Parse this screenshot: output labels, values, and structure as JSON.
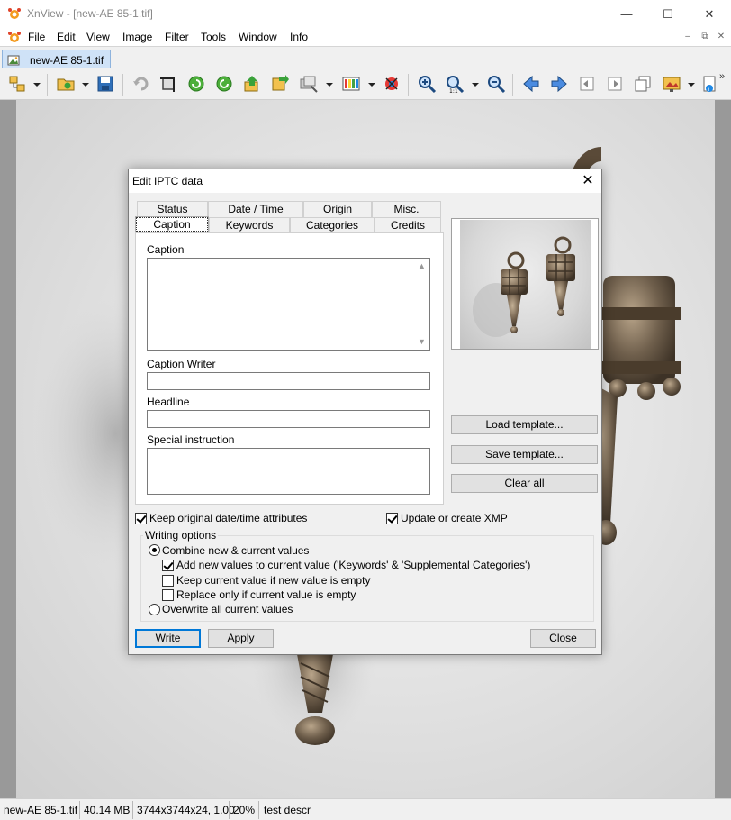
{
  "window": {
    "title": "XnView - [new-AE 85-1.tif]",
    "minimize": "—",
    "maximize": "☐",
    "close": "✕"
  },
  "menu": {
    "items": [
      "File",
      "Edit",
      "View",
      "Image",
      "Filter",
      "Tools",
      "Window",
      "Info"
    ],
    "mdi_minimize": "–",
    "mdi_restore": "⧉",
    "mdi_close": "✕"
  },
  "tabs": {
    "active_label": "new-AE 85-1.tif"
  },
  "toolbar": {
    "icons": [
      "browser-icon",
      "open-icon",
      "save-icon",
      "undo-icon",
      "crop-icon",
      "rotate-left-icon",
      "rotate-right-icon",
      "export-icon",
      "convert-icon",
      "batch-icon",
      "adjust-icon",
      "effects-icon",
      "zoom-in-icon",
      "zoom-actual-icon",
      "zoom-out-icon",
      "prev-icon",
      "next-icon",
      "first-icon",
      "last-icon",
      "multipage-icon",
      "slideshow-icon",
      "info-icon"
    ],
    "overflow": "»"
  },
  "statusbar": {
    "filename": "new-AE 85-1.tif",
    "filesize": "40.14 MB",
    "dimensions": "3744x3744x24, 1.00",
    "zoom": "20%",
    "description": "test descr"
  },
  "dialog": {
    "title": "Edit IPTC data",
    "close": "✕",
    "tabs_back": [
      "Status",
      "Date / Time",
      "Origin",
      "Misc."
    ],
    "tabs_front": [
      "Caption",
      "Keywords",
      "Categories",
      "Credits"
    ],
    "active_tab": "Caption",
    "fields": {
      "caption_label": "Caption",
      "caption_value": "",
      "caption_writer_label": "Caption Writer",
      "caption_writer_value": "",
      "headline_label": "Headline",
      "headline_value": "",
      "special_instruction_label": "Special instruction",
      "special_instruction_value": ""
    },
    "buttons": {
      "load_template": "Load template...",
      "save_template": "Save template...",
      "clear_all": "Clear all",
      "write": "Write",
      "apply": "Apply",
      "close": "Close"
    },
    "options": {
      "keep_date": "Keep original date/time attributes",
      "keep_date_checked": true,
      "update_xmp": "Update or create XMP",
      "update_xmp_checked": true
    },
    "writing_options": {
      "legend": "Writing options",
      "combine": "Combine new & current values",
      "combine_selected": true,
      "add_new": "Add new values to current value ('Keywords' & 'Supplemental Categories')",
      "add_new_checked": true,
      "keep_current": "Keep current value if new value is empty",
      "keep_current_checked": false,
      "replace_only": "Replace only if current value is empty",
      "replace_only_checked": false,
      "overwrite": "Overwrite all current values",
      "overwrite_selected": false
    }
  }
}
